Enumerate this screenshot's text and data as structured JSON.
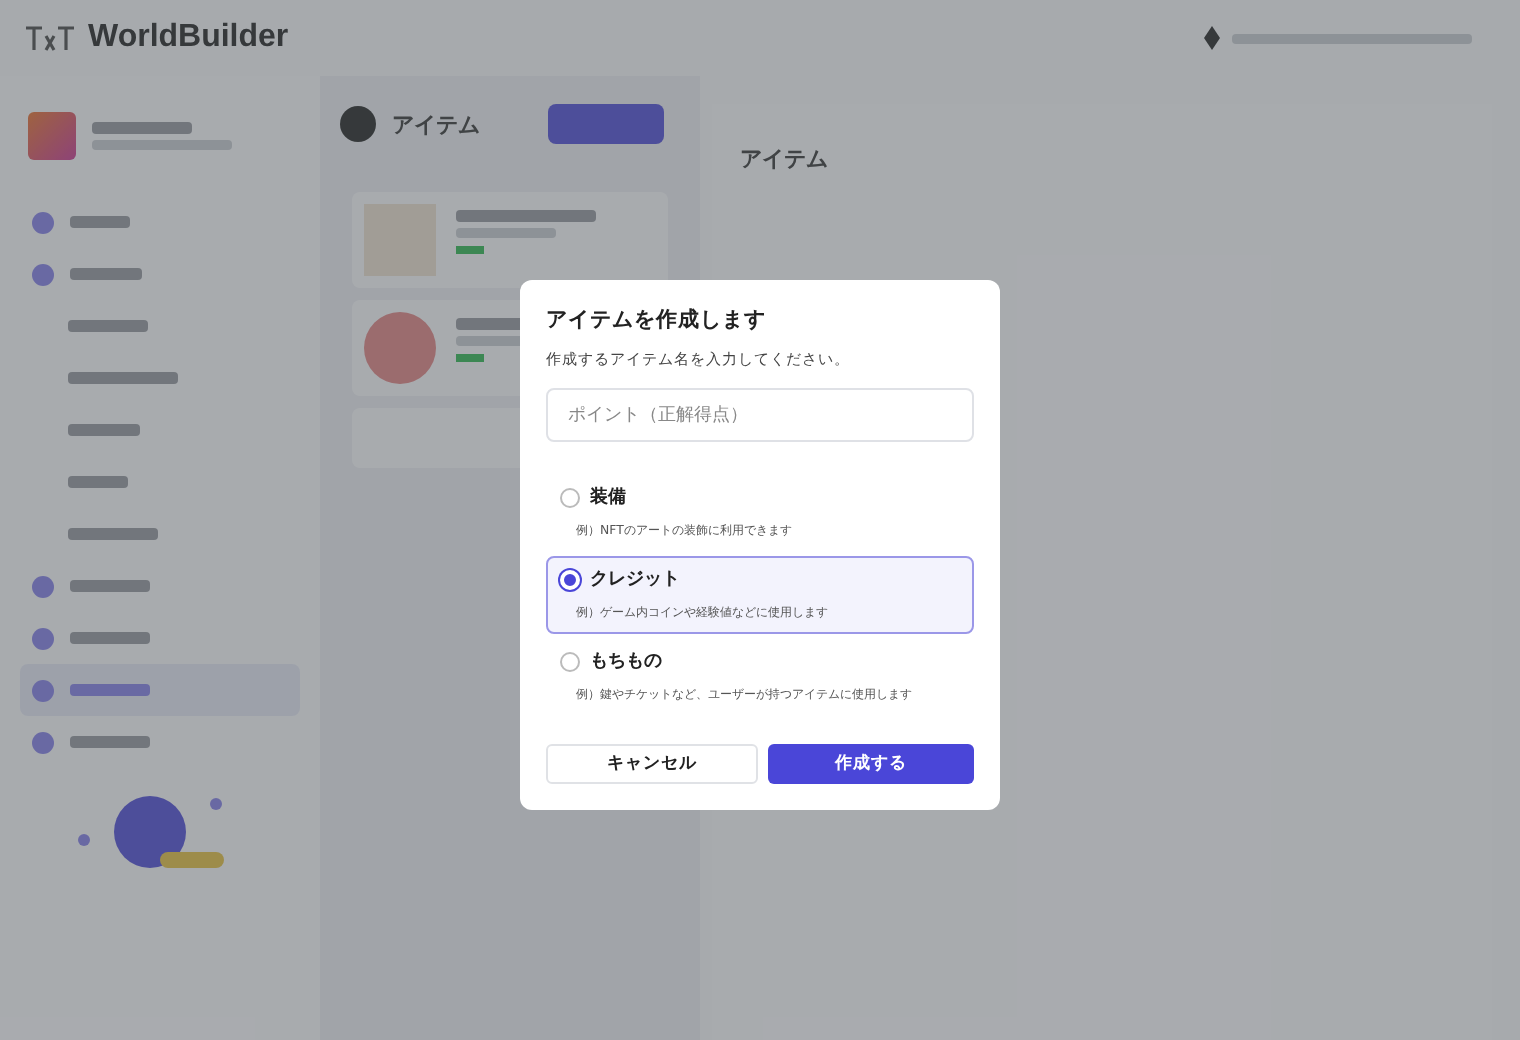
{
  "app": {
    "logo": "WorldBuilder"
  },
  "sidebar": {
    "items": [
      {
        "selected": false
      },
      {
        "selected": false
      },
      {
        "selected": false
      },
      {
        "selected": false
      },
      {
        "selected": true
      },
      {
        "selected": false
      }
    ]
  },
  "list_header": {
    "title": "アイテム"
  },
  "panel": {
    "title": "アイテム"
  },
  "dialog": {
    "title": "アイテムを作成します",
    "description": "作成するアイテム名を入力してください。",
    "field": {
      "placeholder": "ポイント（正解得点）"
    },
    "options": [
      {
        "label": "装備",
        "hint": "例）NFTのアートの装飾に利用できます",
        "selected": false
      },
      {
        "label": "クレジット",
        "hint": "例）ゲーム内コインや経験値などに使用します",
        "selected": true
      },
      {
        "label": "もちもの",
        "hint": "例）鍵やチケットなど、ユーザーが持つアイテムに使用します",
        "selected": false
      }
    ],
    "buttons": [
      {
        "label": "キャンセル",
        "kind": "secondary"
      },
      {
        "label": "作成する",
        "kind": "primary"
      }
    ]
  }
}
